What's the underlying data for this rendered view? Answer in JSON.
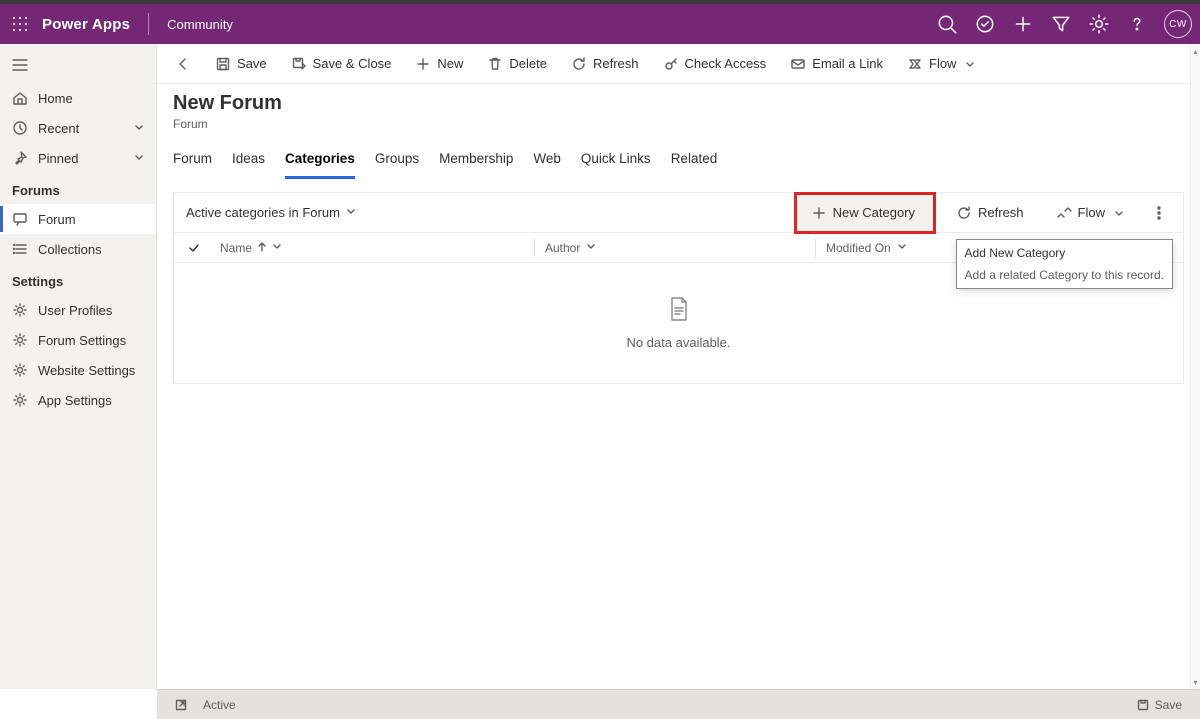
{
  "header": {
    "app": "Power Apps",
    "env": "Community",
    "avatar": "CW"
  },
  "sidebar": {
    "top": [
      {
        "label": "Home"
      },
      {
        "label": "Recent"
      },
      {
        "label": "Pinned"
      }
    ],
    "section_forums": "Forums",
    "forums": [
      {
        "label": "Forum"
      },
      {
        "label": "Collections"
      }
    ],
    "section_settings": "Settings",
    "settings": [
      {
        "label": "User Profiles"
      },
      {
        "label": "Forum Settings"
      },
      {
        "label": "Website Settings"
      },
      {
        "label": "App Settings"
      }
    ]
  },
  "commandbar": {
    "save": "Save",
    "save_close": "Save & Close",
    "new": "New",
    "delete": "Delete",
    "refresh": "Refresh",
    "check_access": "Check Access",
    "email_link": "Email a Link",
    "flow": "Flow"
  },
  "page": {
    "title": "New Forum",
    "subtitle": "Forum"
  },
  "tabs": {
    "items": [
      "Forum",
      "Ideas",
      "Categories",
      "Groups",
      "Membership",
      "Web",
      "Quick Links",
      "Related"
    ],
    "active": "Categories"
  },
  "grid": {
    "view": "Active categories in Forum",
    "cmd": {
      "new_category": "New Category",
      "refresh": "Refresh",
      "flow": "Flow"
    },
    "columns": {
      "name": "Name",
      "author": "Author",
      "modified": "Modified On"
    },
    "empty": "No data available."
  },
  "tooltip": {
    "title": "Add New Category",
    "body": "Add a related Category to this record."
  },
  "statusbar": {
    "status": "Active",
    "save": "Save"
  }
}
